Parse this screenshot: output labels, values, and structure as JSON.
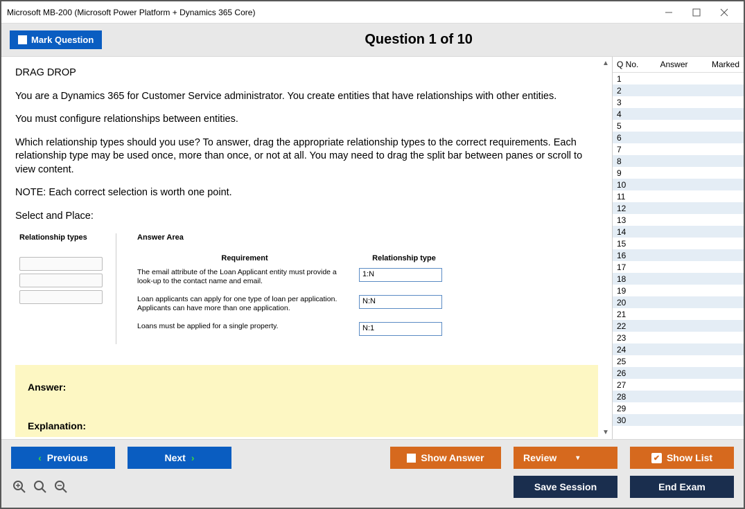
{
  "window": {
    "title": "Microsoft MB-200 (Microsoft Power Platform + Dynamics 365 Core)"
  },
  "header": {
    "mark_label": "Mark Question",
    "question_label": "Question 1 of 10"
  },
  "question": {
    "lead": "DRAG DROP",
    "p1": "You are a Dynamics 365 for Customer Service administrator. You create entities that have relationships with other entities.",
    "p2": "You must configure relationships between entities.",
    "p3": "Which relationship types should you use? To answer, drag the appropriate relationship types to the correct requirements. Each relationship type may be used once, more than once, or not at all. You may need to drag the split bar between panes or scroll to view content.",
    "p4": "NOTE: Each correct selection is worth one point.",
    "p5": "Select and Place:",
    "rel_header": "Relationship types",
    "ans_header": "Answer Area",
    "req_header": "Requirement",
    "reltype_header": "Relationship type",
    "rows": [
      {
        "req": "The email attribute of the Loan Applicant entity must provide a look-up to the contact name and email.",
        "val": "1:N"
      },
      {
        "req": "Loan applicants can apply for one type of loan per application. Applicants can have more than one application.",
        "val": "N:N"
      },
      {
        "req": "Loans must be applied for a single property.",
        "val": "N:1"
      }
    ],
    "answer_label": "Answer:",
    "explanation_label": "Explanation:"
  },
  "sidebar": {
    "h_qno": "Q No.",
    "h_ans": "Answer",
    "h_mark": "Marked",
    "count": 30
  },
  "footer": {
    "previous": "Previous",
    "next": "Next",
    "show_answer": "Show Answer",
    "review": "Review",
    "show_list": "Show List",
    "save_session": "Save Session",
    "end_exam": "End Exam"
  }
}
